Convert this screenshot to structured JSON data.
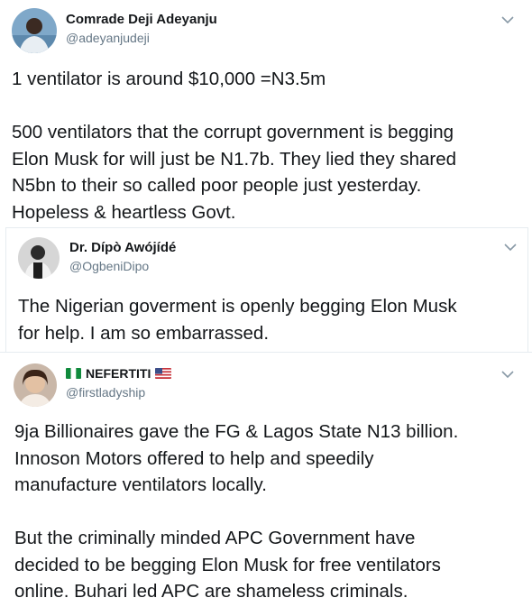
{
  "tweets": [
    {
      "name": "Comrade Deji Adeyanju",
      "handle": "@adeyanjudeji",
      "text": "1 ventilator is around $10,000 =N3.5m\n\n500 ventilators that the corrupt government is begging\nElon Musk for will just be N1.7b. They lied they shared\nN5bn to their so called poor people just yesterday.\nHopeless & heartless Govt.",
      "avatar": "person-avatar-icon"
    },
    {
      "name": "Dr. Dípò Awójídé",
      "handle": "@OgbeniDipo",
      "text": "The Nigerian goverment is openly begging Elon Musk\nfor help. I am so embarrassed.",
      "avatar": "person-avatar-icon"
    },
    {
      "name": "NEFERTITI",
      "handle": "@firstladyship",
      "text": "9ja Billionaires gave the FG & Lagos State N13 billion.\nInnoson Motors offered to help and speedily\nmanufacture ventilators locally.\n\nBut the criminally minded APC Government have\ndecided to be begging Elon Musk for free ventilators\nonline. Buhari led APC are shameless criminals.",
      "avatar": "person-avatar-icon",
      "name_prefix_icon": "nigeria-flag-icon",
      "name_suffix_icon": "us-flag-icon"
    }
  ],
  "colors": {
    "text": "#14171a",
    "secondary": "#657786",
    "border": "#e6ecf0"
  }
}
